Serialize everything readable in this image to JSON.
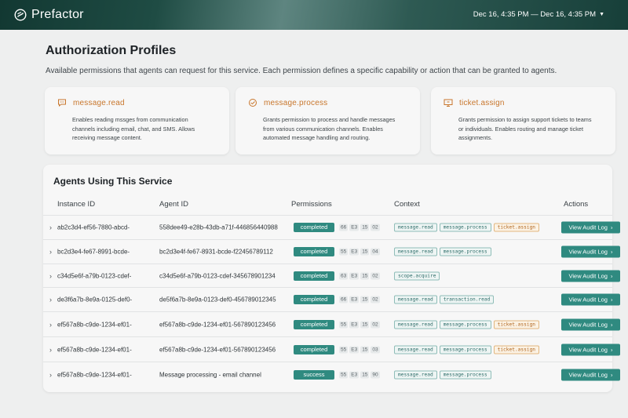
{
  "app": {
    "name": "Prefactor"
  },
  "date_range": "Dec 16, 4:35 PM — Dec 16, 4:35 PM",
  "page": {
    "title": "Authorization Profiles",
    "subtitle": "Available permissions that agents can request for this service. Each permission defines a specific capability or action that can be granted to agents."
  },
  "permissions": [
    {
      "icon": "message-icon",
      "name": "message.read",
      "description": "Enables reading mssges from communication channels including email, chat, and SMS. Allows receiving message content."
    },
    {
      "icon": "process-icon",
      "name": "message.process",
      "description": "Grants permission to process and handle messages from various communication channels. Enables automated message handling and routing."
    },
    {
      "icon": "ticket-icon",
      "name": "ticket.assign",
      "description": "Grants permission to assign support tickets to teams or individuals. Enables routing and manage ticket assignments."
    }
  ],
  "agents": {
    "title": "Agents Using This Service",
    "columns": [
      "Instance ID",
      "Agent ID",
      "Permissions",
      "Context",
      "Actions"
    ],
    "rows": [
      {
        "instance_id": "ab2c3d4-ef56-7880-abcd-",
        "agent_id": "558dee49-e28b-43db-a71f-446856440988",
        "status": "completed",
        "codes": [
          "66",
          "E3",
          "15",
          "02"
        ],
        "context": [
          "message.read",
          "message.process",
          "ticket.assign"
        ],
        "action": "View Audit Log"
      },
      {
        "instance_id": "bc2d3e4-fe67-8991-bcde-",
        "agent_id": "bc2d3e4f-fe67-8931-bcde-f22456789112",
        "status": "completed",
        "codes": [
          "55",
          "E3",
          "15",
          "04"
        ],
        "context": [
          "message.read",
          "message.process"
        ],
        "action": "View Audit Log"
      },
      {
        "instance_id": "c34d5e6f-a79b-0123-cdef-",
        "agent_id": "c34d5e6f-a79b-0123-cdef-345678901234",
        "status": "completed",
        "codes": [
          "63",
          "E3",
          "15",
          "02"
        ],
        "context": [
          "scope.acquire"
        ],
        "action": "View Audit Log"
      },
      {
        "instance_id": "de3f6a7b-8e9a-0125-def0-",
        "agent_id": "de5f6a7b-8e9a-0123-def0-456789012345",
        "status": "completed",
        "codes": [
          "66",
          "E3",
          "15",
          "02"
        ],
        "context": [
          "message.read",
          "transaction.read"
        ],
        "action": "View Audit Log"
      },
      {
        "instance_id": "ef567a8b-c9de-1234-ef01-",
        "agent_id": "ef567a8b-c9de-1234-ef01-567890123456",
        "status": "completed",
        "codes": [
          "55",
          "E3",
          "15",
          "02"
        ],
        "context": [
          "message.read",
          "message.process",
          "ticket.assign"
        ],
        "action": "View Audit Log"
      },
      {
        "instance_id": "ef567a8b-c9de-1234-ef01-",
        "agent_id": "ef567a8b-c9de-1234-ef01-567890123456",
        "status": "completed",
        "codes": [
          "55",
          "E3",
          "15",
          "03"
        ],
        "context": [
          "message.read",
          "message.process",
          "ticket.assign"
        ],
        "action": "View Audit Log"
      },
      {
        "instance_id": "ef567a8b-c9de-1234-ef01-",
        "agent_id": "Message processing - email channel",
        "status": "success",
        "codes": [
          "55",
          "E3",
          "15",
          "90"
        ],
        "context": [
          "message.read",
          "message.process"
        ],
        "action": "View Audit Log"
      }
    ]
  },
  "colors": {
    "accent": "#2f8a80",
    "permission_orange": "#c8762c"
  }
}
